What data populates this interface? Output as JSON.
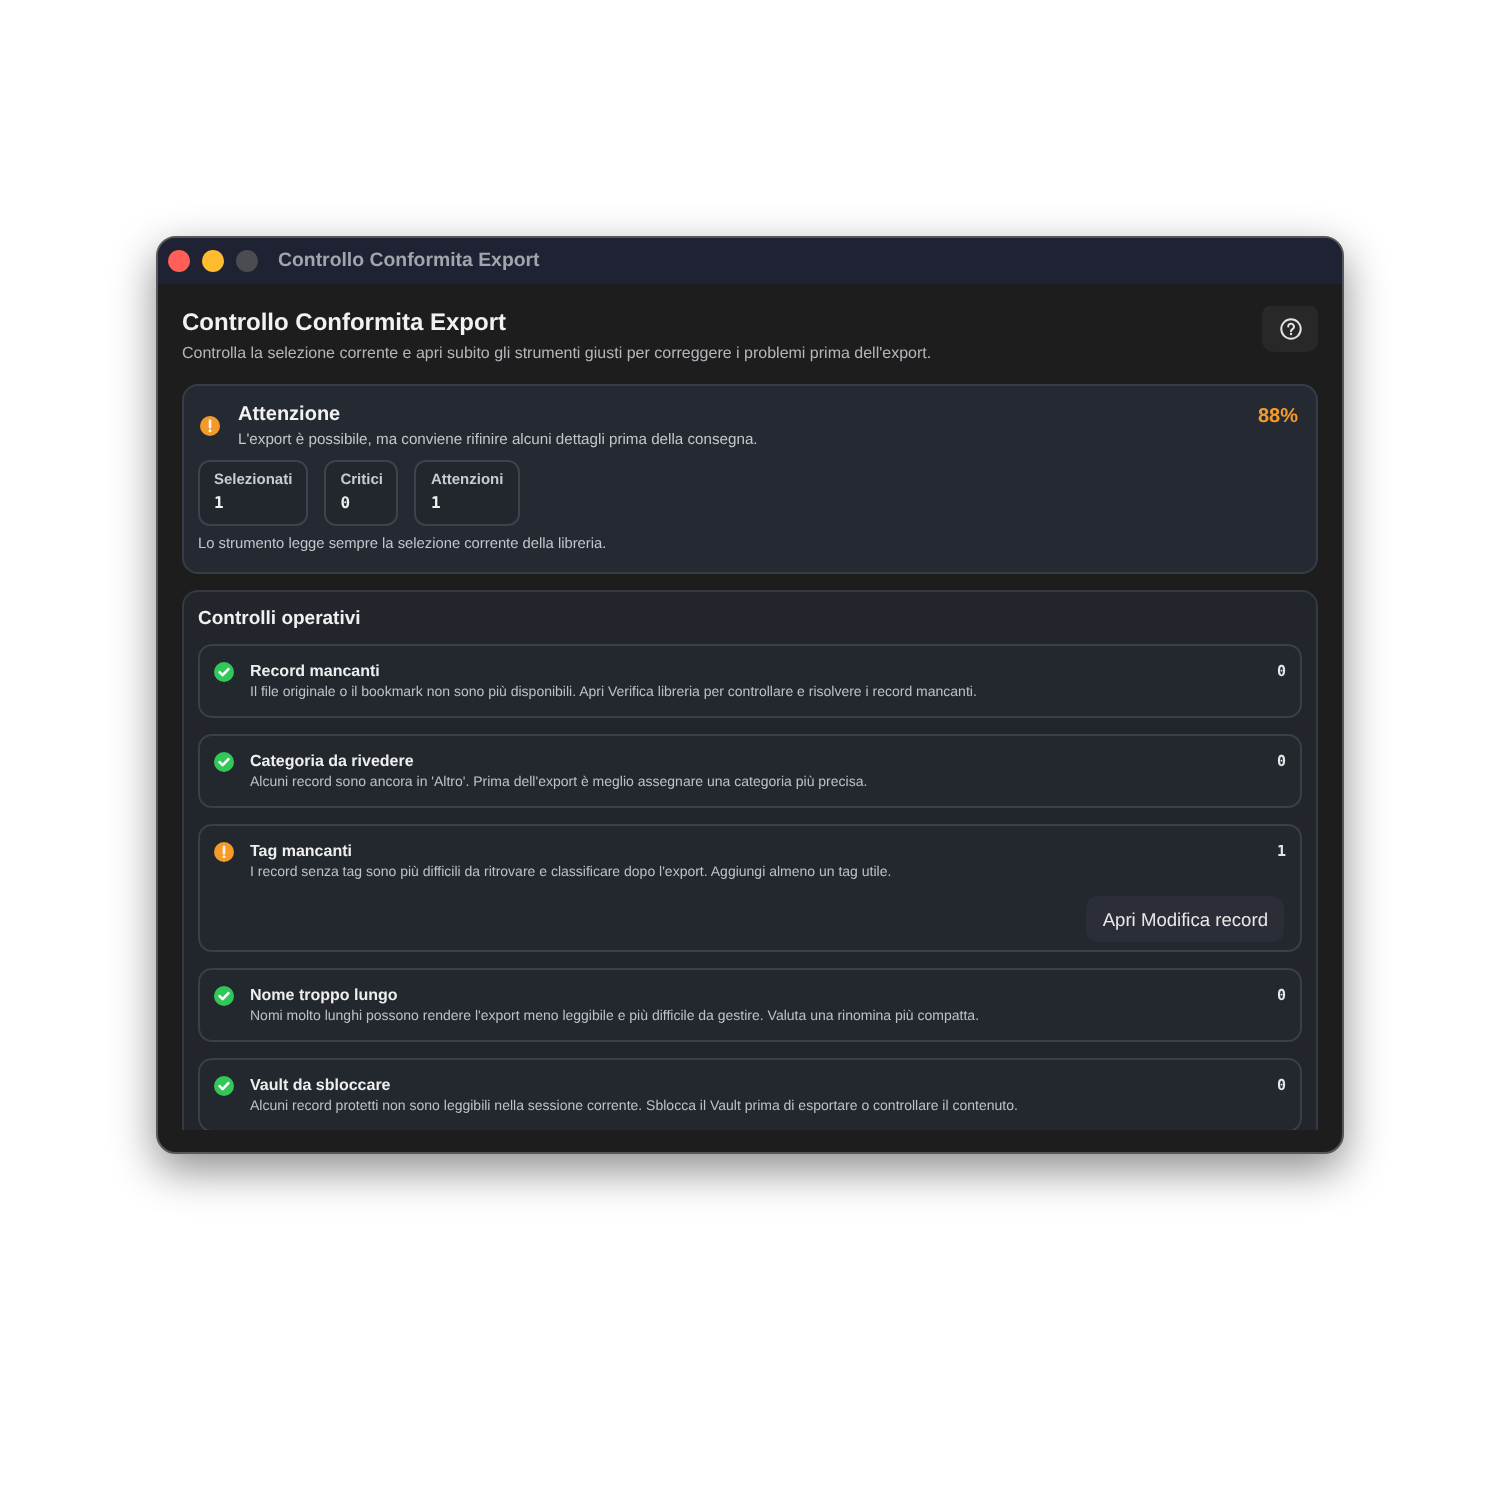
{
  "window": {
    "title": "Controllo Conformita Export",
    "controls": [
      {
        "kind": "close",
        "disabled": false
      },
      {
        "kind": "minimize",
        "disabled": false
      },
      {
        "kind": "zoom",
        "disabled": true
      }
    ]
  },
  "header": {
    "title": "Controllo Conformita Export",
    "subtitle": "Controlla la selezione corrente e apri subito gli strumenti giusti per correggere i problemi prima dell'export."
  },
  "summary": {
    "kind": "warning",
    "title": "Attenzione",
    "description": "L'export è possibile, ma conviene rifinire alcuni dettagli prima della consegna.",
    "score": "88%",
    "stats": [
      {
        "label": "Selezionati",
        "value": "1"
      },
      {
        "label": "Critici",
        "value": "0"
      },
      {
        "label": "Attenzioni",
        "value": "1"
      }
    ],
    "note": "Lo strumento legge sempre la selezione corrente della libreria."
  },
  "checks": {
    "title": "Controlli operativi",
    "items": [
      {
        "kind": "ok",
        "title": "Record mancanti",
        "description": "Il file originale o il bookmark non sono più disponibili. Apri Verifica libreria per controllare e risolvere i record mancanti.",
        "count": "0"
      },
      {
        "kind": "ok",
        "title": "Categoria da rivedere",
        "description": "Alcuni record sono ancora in 'Altro'. Prima dell'export è meglio assegnare una categoria più precisa.",
        "count": "0"
      },
      {
        "kind": "warning",
        "title": "Tag mancanti",
        "description": "I record senza tag sono più difficili da ritrovare e classificare dopo l'export. Aggiungi almeno un tag utile.",
        "count": "1",
        "action": "Apri Modifica record"
      },
      {
        "kind": "ok",
        "title": "Nome troppo lungo",
        "description": "Nomi molto lunghi possono rendere l'export meno leggibile e più difficile da gestire. Valuta una rinomina più compatta.",
        "count": "0"
      },
      {
        "kind": "ok",
        "title": "Vault da sbloccare",
        "description": "Alcuni record protetti non sono leggibili nella sessione corrente. Sblocca il Vault prima di esportare o controllare il contenuto.",
        "count": "0"
      }
    ]
  }
}
